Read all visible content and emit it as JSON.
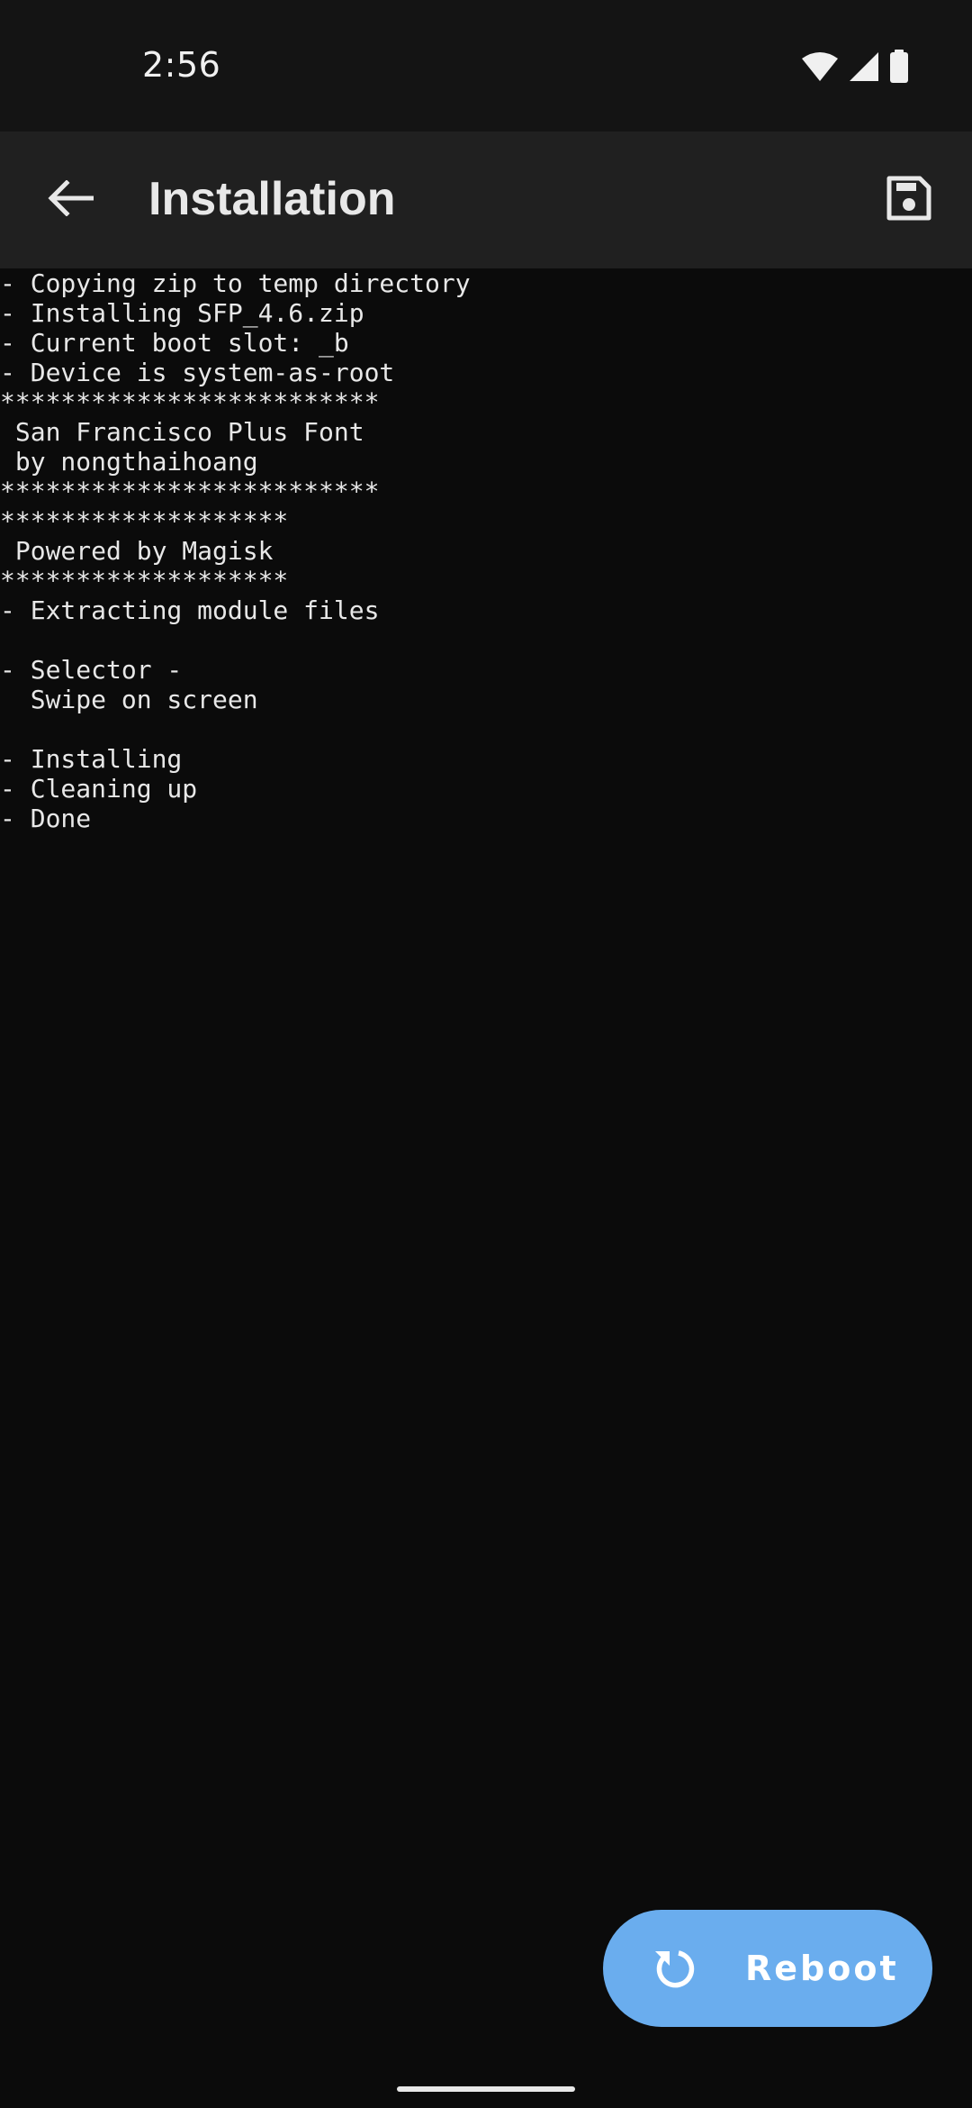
{
  "status_bar": {
    "time": "2:56",
    "icons": [
      "wifi-icon",
      "cellular-signal-icon",
      "battery-icon"
    ]
  },
  "app_bar": {
    "title": "Installation",
    "back_icon": "arrow-back-icon",
    "save_icon": "save-icon"
  },
  "console": {
    "lines": [
      "- Copying zip to temp directory",
      "- Installing SFP_4.6.zip",
      "- Current boot slot: _b",
      "- Device is system-as-root",
      "*************************",
      " San Francisco Plus Font",
      " by nongthaihoang",
      "*************************",
      "*******************",
      " Powered by Magisk",
      "*******************",
      "- Extracting module files",
      "",
      "- Selector -",
      "  Swipe on screen",
      "",
      "- Installing",
      "- Cleaning up",
      "- Done"
    ]
  },
  "fab": {
    "label": "Reboot",
    "icon": "restart-icon",
    "color": "#6aadee"
  },
  "colors": {
    "background": "#0b0b0b",
    "app_bar": "#202020",
    "status_bar": "#141414",
    "text": "#e8e8e8"
  }
}
